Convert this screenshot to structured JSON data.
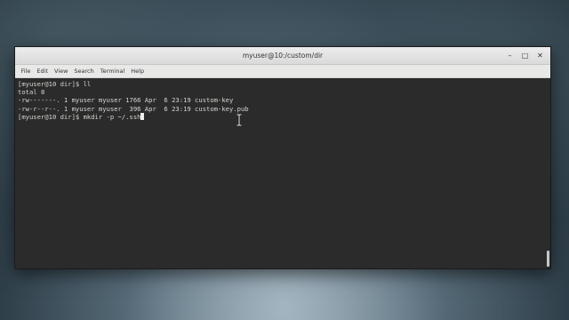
{
  "window": {
    "title": "myuser@10:/custom/dir",
    "controls": {
      "minimize": "–",
      "maximize": "□",
      "close": "✕"
    }
  },
  "menubar": {
    "items": [
      "File",
      "Edit",
      "View",
      "Search",
      "Terminal",
      "Help"
    ]
  },
  "terminal": {
    "lines": [
      "[myuser@10 dir]$ ll",
      "total 8",
      "-rw-------. 1 myuser myuser 1766 Apr  6 23:19 custom-key",
      "-rw-r--r--. 1 myuser myuser  396 Apr  6 23:19 custom-key.pub",
      "[myuser@10 dir]$ mkdir -p ~/.ssh"
    ]
  },
  "colors": {
    "terminal_bg": "#2b2b2b",
    "terminal_fg": "#d3d7cf",
    "titlebar_bg": "#e0e0e0"
  },
  "icons": {
    "mouse_cursor": "text-cursor-icon"
  }
}
